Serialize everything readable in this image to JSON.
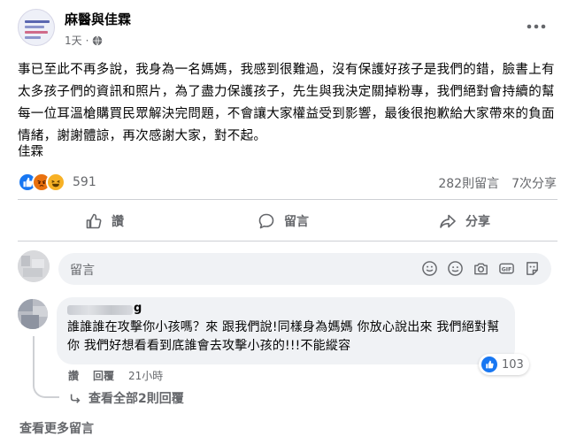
{
  "post": {
    "page_name": "麻醫與佳霖",
    "time": "1天",
    "text": "事已至此不再多說，我身為一名媽媽，我感到很難過，沒有保護好孩子是我們的錯，臉書上有太多孩子們的資訊和照片，為了盡力保護孩子，先生與我決定關掉粉專，我們絕對會持續的幫每一位耳溫槍購買民眾解決完問題，不會讓大家權益受到影響，最後很抱歉給大家帶來的負面情緒，謝謝體諒，再次感謝大家，對不起。",
    "signature": "佳霖"
  },
  "stats": {
    "reaction_count": "591",
    "comments": "282則留言",
    "shares": "7次分享"
  },
  "actions": {
    "like": "讚",
    "comment": "留言",
    "share": "分享"
  },
  "composer": {
    "placeholder": "留言"
  },
  "comment": {
    "author_suffix": "g",
    "text": "誰誰誰在攻擊你小孩嗎？來 跟我們說!同樣身為媽媽 你放心說出來 我們絕對幫你 我們好想看看到底誰會去攻擊小孩的!!!不能縱容",
    "likes": "103",
    "like_action": "讚",
    "reply_action": "回覆",
    "time": "21小時",
    "view_replies": "查看全部2則回覆"
  },
  "footer": {
    "more_comments": "查看更多留言"
  },
  "colors": {
    "link_gray": "#65676b",
    "like_blue": "#1877f2",
    "bubble_gray": "#f0f2f5",
    "divider": "#ced0d4"
  },
  "icons": [
    "globe-icon",
    "more-icon",
    "like-icon",
    "comment-icon",
    "share-icon",
    "sticker-icon",
    "emoji-icon",
    "camera-icon",
    "gif-icon",
    "stamp-icon"
  ]
}
